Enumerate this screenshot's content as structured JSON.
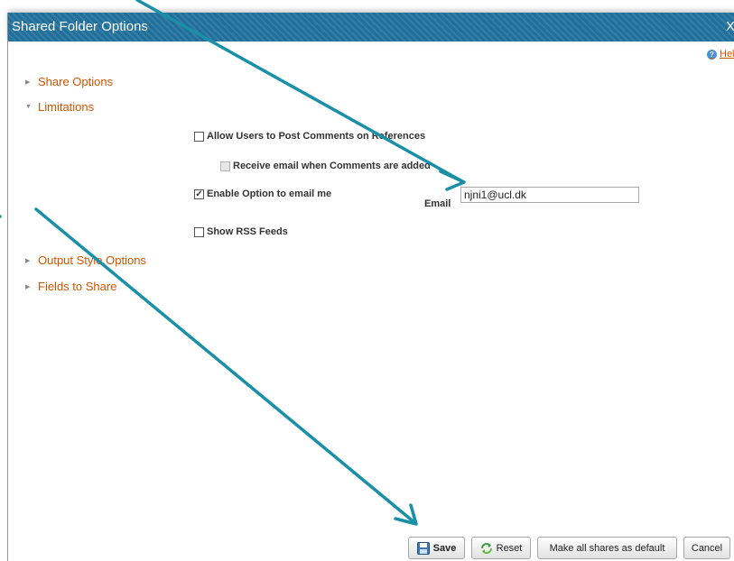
{
  "dialog": {
    "title": "Shared Folder Options",
    "close_label": "X",
    "help_label": "Help"
  },
  "sections": {
    "share_options": "Share Options",
    "limitations": "Limitations",
    "output_style_options": "Output Style Options",
    "fields_to_share": "Fields to Share"
  },
  "limitations": {
    "allow_comments": {
      "label": "Allow Users to Post Comments on References",
      "checked": false
    },
    "receive_email": {
      "label": "Receive email when Comments are added",
      "checked": false,
      "disabled": true
    },
    "enable_email": {
      "label": "Enable Option to email me",
      "checked": true
    },
    "email_label": "Email",
    "email_value": "njni1@ucl.dk",
    "rss": {
      "label": "Show RSS Feeds",
      "checked": false
    }
  },
  "buttons": {
    "save": "Save",
    "reset": "Reset",
    "make_default": "Make all shares as default",
    "cancel": "Cancel"
  },
  "colors": {
    "titlebar": "#1f6f9b",
    "section_link": "#d35400",
    "annotation_arrow": "#1a8fa8"
  },
  "icons": {
    "help": "help-circle-icon",
    "save": "floppy-disk-icon",
    "reset": "recycle-arrows-icon",
    "collapsed": "triangle-right-icon",
    "expanded": "triangle-down-icon"
  }
}
